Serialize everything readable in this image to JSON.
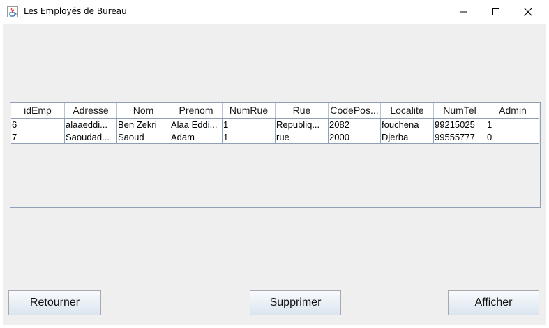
{
  "window": {
    "title": "Les Employés de Bureau",
    "app_icon": "java-coffee-cup-icon",
    "controls": [
      "minimize-icon",
      "maximize-icon",
      "close-icon"
    ]
  },
  "table": {
    "columns": [
      "idEmp",
      "Adresse",
      "Nom",
      "Prenom",
      "NumRue",
      "Rue",
      "CodePos...",
      "Localite",
      "NumTel",
      "Admin"
    ],
    "rows": [
      [
        "6",
        "alaaeddi...",
        "Ben Zekri",
        "Alaa Eddi...",
        "1",
        "Republiq...",
        "2082",
        "fouchena",
        "99215025",
        "1"
      ],
      [
        "7",
        "Saoudad...",
        "Saoud",
        "Adam",
        "1",
        "rue",
        "2000",
        "Djerba",
        "99555777",
        "0"
      ]
    ]
  },
  "buttons": {
    "return_label": "Retourner",
    "delete_label": "Supprimer",
    "show_label": "Afficher"
  },
  "colors": {
    "client_bg": "#efefef",
    "grid_line": "#8fa0b4",
    "button_gradient_top": "#f8fbfe",
    "button_gradient_bottom": "#dbe4ee"
  }
}
